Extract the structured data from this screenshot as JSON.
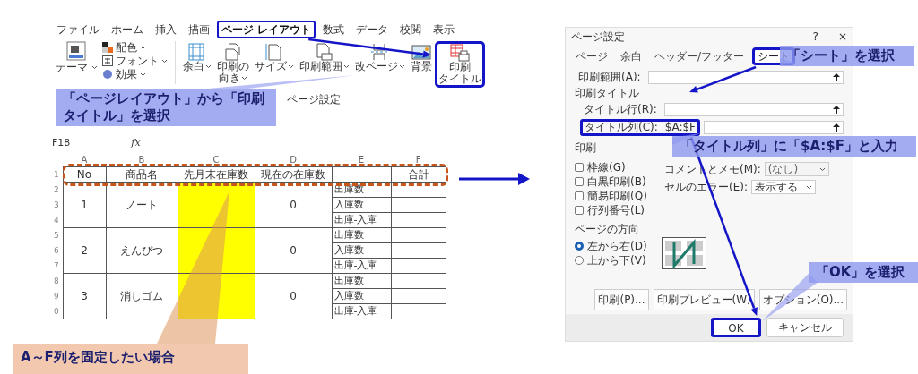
{
  "excel": {
    "tabs": [
      {
        "label": "ファイル",
        "selected": false
      },
      {
        "label": "ホーム",
        "selected": false
      },
      {
        "label": "挿入",
        "selected": false
      },
      {
        "label": "描画",
        "selected": false
      },
      {
        "label": "ページ レイアウト",
        "selected": true
      },
      {
        "label": "数式",
        "selected": false
      },
      {
        "label": "データ",
        "selected": false
      },
      {
        "label": "校閲",
        "selected": false
      },
      {
        "label": "表示",
        "selected": false
      }
    ],
    "theme": {
      "label": "テーマ"
    },
    "theme_options": [
      "配色",
      "フォント",
      "効果"
    ],
    "commands": [
      {
        "lines": [
          "余白"
        ],
        "dropdown": true,
        "outlined": false
      },
      {
        "lines": [
          "印刷の",
          "向き"
        ],
        "dropdown": true,
        "outlined": false
      },
      {
        "lines": [
          "サイズ"
        ],
        "dropdown": true,
        "outlined": false
      },
      {
        "lines": [
          "印刷範囲"
        ],
        "dropdown": true,
        "outlined": false
      },
      {
        "lines": [
          "改ページ"
        ],
        "dropdown": true,
        "outlined": false
      },
      {
        "lines": [
          "背景"
        ],
        "dropdown": false,
        "outlined": false
      },
      {
        "lines": [
          "印刷",
          "タイトル"
        ],
        "dropdown": false,
        "outlined": true
      }
    ],
    "group_label": "ページ設定",
    "name_box": "F18",
    "function_label": "fx",
    "column_letters": [
      "A",
      "B",
      "C",
      "D",
      "E",
      "F"
    ],
    "header": [
      {
        "kind": "text",
        "text": "No"
      },
      {
        "kind": "text",
        "text": "商品名"
      },
      {
        "kind": "text",
        "text": "先月末在庫数"
      },
      {
        "kind": "text",
        "text": "現在の在庫数"
      },
      {
        "kind": "blank"
      },
      {
        "kind": "text",
        "text": "合計"
      }
    ],
    "row_numbers": [
      "1",
      "2",
      "3",
      "4",
      "5",
      "6",
      "7",
      "8",
      "9",
      "0"
    ],
    "items": [
      {
        "no": "1",
        "name": "ノート",
        "current": "0",
        "labels": [
          "出庫数",
          "入庫数",
          "出庫-入庫"
        ]
      },
      {
        "no": "2",
        "name": "えんぴつ",
        "current": "0",
        "labels": [
          "出庫数",
          "入庫数",
          "出庫-入庫"
        ]
      },
      {
        "no": "3",
        "name": "消しゴム",
        "current": "0",
        "labels": [
          "出庫数",
          "入庫数",
          "出庫-入庫"
        ]
      }
    ]
  },
  "dialog": {
    "title": "ページ設定",
    "help": "?",
    "close": "×",
    "tabs": [
      {
        "label": "ページ",
        "selected": false,
        "outlined": false
      },
      {
        "label": "余白",
        "selected": false,
        "outlined": false
      },
      {
        "label": "ヘッダー/フッター",
        "selected": false,
        "outlined": false
      },
      {
        "label": "シート",
        "selected": true,
        "outlined": true
      }
    ],
    "print_area": {
      "label": "印刷範囲(A):"
    },
    "print_titles_label": "印刷タイトル",
    "title_fields": [
      {
        "label": "タイトル行(R):",
        "outlined": false
      },
      {
        "label": "タイトル列(C):",
        "value": "$A:$F",
        "outlined": true
      }
    ],
    "print_label": "印刷",
    "checkboxes": [
      {
        "label": "枠線(G)",
        "checked": false
      },
      {
        "label": "白黒印刷(B)",
        "checked": false
      },
      {
        "label": "簡易印刷(Q)",
        "checked": false
      },
      {
        "label": "行列番号(L)",
        "checked": false
      }
    ],
    "selects": [
      {
        "label": "コメントとメモ(M):",
        "value": "(なし)",
        "disabled": true
      },
      {
        "label": "セルのエラー(E):",
        "value": "表示する",
        "disabled": false
      }
    ],
    "order_label": "ページの方向",
    "orders": [
      {
        "label": "左から右(D)",
        "selected": true
      },
      {
        "label": "上から下(V)",
        "selected": false
      }
    ],
    "buttons": [
      "印刷(P)...",
      "印刷プレビュー(W)",
      "オプション(O)..."
    ],
    "footer_buttons": [
      {
        "label": "OK",
        "outlined": true
      },
      {
        "label": "キャンセル",
        "outlined": false
      }
    ]
  },
  "callouts": [
    {
      "kind": "blue",
      "text": "「ページレイアウト」から「印刷タイトル」を選択"
    },
    {
      "kind": "peach",
      "text": "A～F列を固定したい場合"
    },
    {
      "kind": "blue",
      "text": "「シート」を選択"
    },
    {
      "kind": "blue",
      "text": "「タイトル列」に「$A:$F」と入力"
    },
    {
      "kind": "blue",
      "text": "「OK」を選択"
    }
  ]
}
